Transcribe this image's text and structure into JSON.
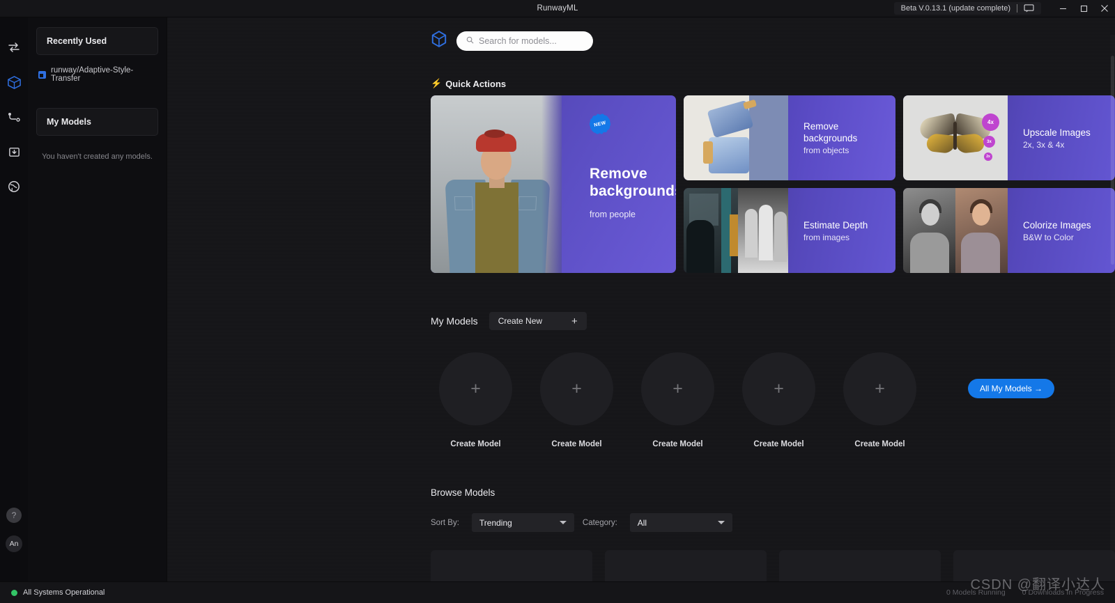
{
  "titlebar": {
    "title": "RunwayML",
    "beta_label": "Beta V.0.13.1 (update complete)",
    "chat_icon": "chat-bubble-icon",
    "minimize": "minimize-icon",
    "maximize": "maximize-icon",
    "close": "close-icon"
  },
  "rail": {
    "items": [
      {
        "icon": "transfer-arrows-icon",
        "active": false
      },
      {
        "icon": "cube-icon",
        "active": true
      },
      {
        "icon": "workflow-node-icon",
        "active": false
      },
      {
        "icon": "download-box-icon",
        "active": false
      },
      {
        "icon": "globe-icon",
        "active": false
      }
    ],
    "help_label": "?",
    "avatar_label": "An"
  },
  "sidebar": {
    "recently_used_header": "Recently Used",
    "recent_item": "runway/Adaptive-Style-Transfer",
    "my_models_header": "My Models",
    "empty_message": "You haven't created any models."
  },
  "search": {
    "placeholder": "Search for models...",
    "value": "",
    "icon": "search-icon",
    "logo": "cube-logo-icon"
  },
  "quick_actions": {
    "heading": "Quick Actions",
    "bolt_icon": "lightning-bolt-icon",
    "hero": {
      "badge": "NEW",
      "title_line1": "Remove",
      "title_line2": "backgrounds",
      "subtitle": "from people"
    },
    "cards": [
      {
        "title_line1": "Remove",
        "title_line2": "backgrounds",
        "subtitle": "from objects",
        "thumb": "jars-photo"
      },
      {
        "title_line1": "Upscale Images",
        "title_line2": "",
        "subtitle": "2x, 3x & 4x",
        "thumb": "butterfly-photo",
        "bubbles": [
          "4x",
          "3x",
          "2x"
        ]
      },
      {
        "title_line1": "Estimate Depth",
        "title_line2": "",
        "subtitle": "from images",
        "thumb": "depth-photo"
      },
      {
        "title_line1": "Colorize Images",
        "title_line2": "",
        "subtitle": "B&W to Color",
        "thumb": "colorize-photo"
      }
    ]
  },
  "my_models": {
    "title": "My Models",
    "create_new_label": "Create New",
    "create_new_plus": "+",
    "tiles": [
      {
        "plus": "+",
        "label": "Create Model"
      },
      {
        "plus": "+",
        "label": "Create Model"
      },
      {
        "plus": "+",
        "label": "Create Model"
      },
      {
        "plus": "+",
        "label": "Create Model"
      },
      {
        "plus": "+",
        "label": "Create Model"
      }
    ],
    "all_models_label": "All My Models →"
  },
  "browse": {
    "title": "Browse Models",
    "sort_label": "Sort By:",
    "sort_value": "Trending",
    "category_label": "Category:",
    "category_value": "All"
  },
  "status": {
    "system_status": "All Systems Operational",
    "models_running": "0 Models Running",
    "downloads": "0 Downloads In Progress",
    "watermark": "CSDN @翻译小达人"
  }
}
